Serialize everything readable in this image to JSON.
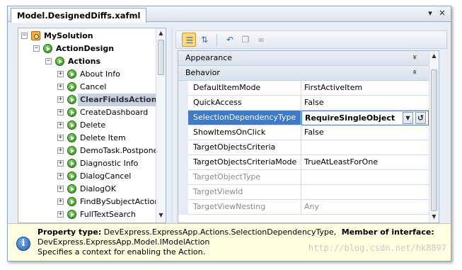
{
  "document_tab": {
    "title": "Model.DesignedDiffs.xafml",
    "menu_glyph": "▾",
    "close_glyph": "✕"
  },
  "tree": {
    "nodes": [
      {
        "label": "MySolution",
        "icon": "solution-icon",
        "bold": true,
        "expander": "−"
      },
      {
        "label": "ActionDesign",
        "icon": "green-node-icon",
        "bold": true,
        "expander": "−"
      },
      {
        "label": "Actions",
        "icon": "green-node-icon",
        "bold": true,
        "expander": "−"
      },
      {
        "label": "About Info",
        "icon": "green-node-icon",
        "expander": "+"
      },
      {
        "label": "Cancel",
        "icon": "green-node-icon",
        "expander": "+"
      },
      {
        "label": "ClearFieldsAction",
        "icon": "green-node-icon",
        "expander": "+",
        "selected": true
      },
      {
        "label": "CreateDashboard",
        "icon": "green-node-icon",
        "expander": "+"
      },
      {
        "label": "Delete",
        "icon": "green-node-icon",
        "expander": "+"
      },
      {
        "label": "Delete Item",
        "icon": "green-node-icon",
        "expander": "+"
      },
      {
        "label": "DemoTask.Postpone",
        "icon": "green-node-icon",
        "expander": "+"
      },
      {
        "label": "Diagnostic Info",
        "icon": "green-node-icon",
        "expander": "+"
      },
      {
        "label": "DialogCancel",
        "icon": "green-node-icon",
        "expander": "+"
      },
      {
        "label": "DialogOK",
        "icon": "green-node-icon",
        "expander": "+"
      },
      {
        "label": "FindBySubjectAction",
        "icon": "green-node-icon",
        "expander": "+"
      },
      {
        "label": "FullTextSearch",
        "icon": "green-node-icon",
        "expander": "+"
      }
    ],
    "scroll_up_glyph": "▲",
    "scroll_down_glyph": "▼"
  },
  "toolbar": {
    "buttons": [
      {
        "name": "categorized-view-icon",
        "glyph": "☰",
        "active": true
      },
      {
        "name": "alphabetical-sort-icon",
        "glyph": "⇅",
        "active": false
      },
      {
        "name": "undo-icon",
        "glyph": "↶",
        "active": false
      },
      {
        "name": "copy-icon",
        "glyph": "❐",
        "active": false
      },
      {
        "name": "link-icon",
        "glyph": "∞",
        "active": false
      }
    ]
  },
  "property_grid": {
    "categories": [
      {
        "label": "Appearance",
        "chevron": "»",
        "expanded": false
      },
      {
        "label": "Behavior",
        "chevron": "«",
        "expanded": true
      }
    ],
    "properties": [
      {
        "name": "DefaultItemMode",
        "value": "FirstActiveItem"
      },
      {
        "name": "QuickAccess",
        "value": "False"
      },
      {
        "name": "SelectionDependencyType",
        "value": "RequireSingleObject",
        "selected": true
      },
      {
        "name": "ShowItemsOnClick",
        "value": "False"
      },
      {
        "name": "TargetObjectsCriteria",
        "value": ""
      },
      {
        "name": "TargetObjectsCriteriaMode",
        "value": "TrueAtLeastForOne"
      },
      {
        "name": "TargetObjectType",
        "value": "",
        "disabled": true
      },
      {
        "name": "TargetViewId",
        "value": "",
        "disabled": true
      },
      {
        "name": "TargetViewNesting",
        "value": "Any",
        "disabled": true
      }
    ],
    "dropdown_glyph": "▼",
    "reset_glyph": "↺",
    "scroll_up_glyph": "▲",
    "scroll_down_glyph": "▼"
  },
  "info_panel": {
    "icon_glyph": "i",
    "property_type_label": "Property type:",
    "property_type_value": "DevExpress.ExpressApp.Actions.SelectionDependencyType,",
    "member_label": "Member of interface:",
    "member_value": "DevExpress.ExpressApp.Model.IModelAction",
    "description": "Specifies a context for enabling the Action."
  },
  "watermark": "http://blog.csdn.net/hk8897"
}
